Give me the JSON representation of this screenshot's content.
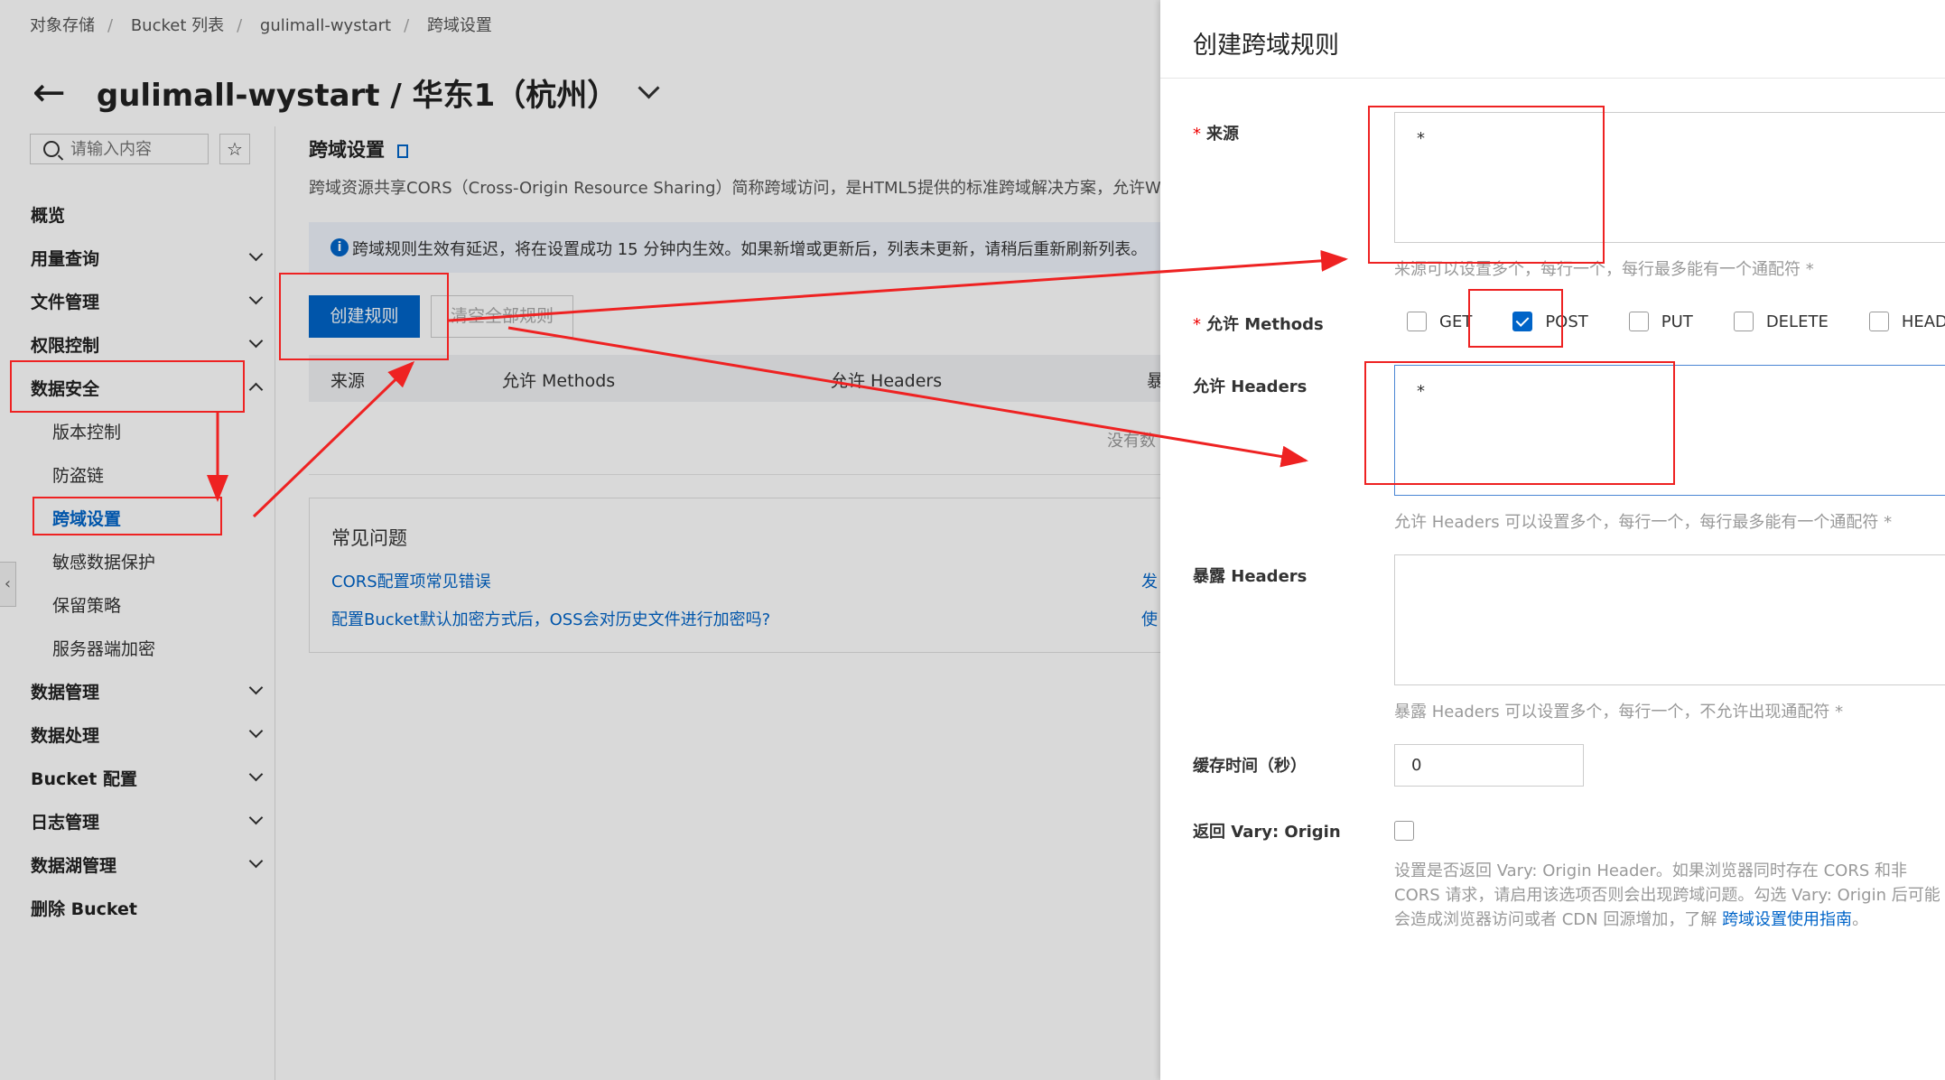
{
  "breadcrumb": [
    "对象存储",
    "Bucket 列表",
    "gulimall-wystart",
    "跨域设置"
  ],
  "breadcrumb_sep": "/",
  "page": {
    "back_icon": "arrow-left-icon",
    "title": "gulimall-wystart / 华东1（杭州）"
  },
  "search": {
    "placeholder": "请输入内容"
  },
  "sidebar": {
    "items": [
      {
        "label": "概览"
      },
      {
        "label": "用量查询"
      },
      {
        "label": "文件管理"
      },
      {
        "label": "权限控制"
      },
      {
        "label": "数据安全"
      },
      {
        "label": "版本控制"
      },
      {
        "label": "防盗链"
      },
      {
        "label": "跨域设置"
      },
      {
        "label": "敏感数据保护"
      },
      {
        "label": "保留策略"
      },
      {
        "label": "服务器端加密"
      },
      {
        "label": "数据管理"
      },
      {
        "label": "数据处理"
      },
      {
        "label": "Bucket 配置"
      },
      {
        "label": "日志管理"
      },
      {
        "label": "数据湖管理"
      },
      {
        "label": "删除 Bucket"
      }
    ]
  },
  "main": {
    "section_title": "跨域设置",
    "description": "跨域资源共享CORS（Cross-Origin Resource Sharing）简称跨域访问，是HTML5提供的标准跨域解决方案，允许Web应",
    "notice": "跨域规则生效有延迟，将在设置成功 15 分钟内生效。如果新增或更新后，列表未更新，请稍后重新刷新列表。",
    "create_button": "创建规则",
    "clear_button": "清空全部规则",
    "table_headers": [
      "来源",
      "允许 Methods",
      "允许 Headers",
      "暴"
    ],
    "empty_text": "没有数",
    "faq": {
      "title": "常见问题",
      "links": [
        "CORS配置项常见错误",
        "配置Bucket默认加密方式后，OSS会对历史文件进行加密吗?"
      ],
      "right_links": [
        "发",
        "使"
      ]
    }
  },
  "drawer": {
    "title": "创建跨域规则",
    "origin": {
      "label": "来源",
      "value": "*",
      "hint": "来源可以设置多个，每行一个，每行最多能有一个通配符 *"
    },
    "methods": {
      "label": "允许 Methods",
      "options": [
        {
          "label": "GET",
          "checked": false
        },
        {
          "label": "POST",
          "checked": true
        },
        {
          "label": "PUT",
          "checked": false
        },
        {
          "label": "DELETE",
          "checked": false
        },
        {
          "label": "HEAD",
          "checked": false
        }
      ]
    },
    "allow_headers": {
      "label": "允许 Headers",
      "value": "*",
      "hint": "允许 Headers 可以设置多个，每行一个，每行最多能有一个通配符 *"
    },
    "expose_headers": {
      "label": "暴露 Headers",
      "value": "",
      "hint": "暴露 Headers 可以设置多个，每行一个，不允许出现通配符 *"
    },
    "cache": {
      "label": "缓存时间（秒）",
      "value": "0"
    },
    "vary": {
      "label": "返回 Vary: Origin",
      "checked": false,
      "note": "设置是否返回 Vary: Origin Header。如果浏览器同时存在 CORS 和非 CORS 请求，请启用该选项否则会出现跨域问题。勾选 Vary: Origin 后可能会造成浏览器访问或者 CDN 回源增加，了解 ",
      "link": "跨域设置使用指南",
      "end": "。"
    }
  },
  "colors": {
    "primary": "#0064c8",
    "annotation": "#e22222",
    "required": "#ee0000"
  }
}
